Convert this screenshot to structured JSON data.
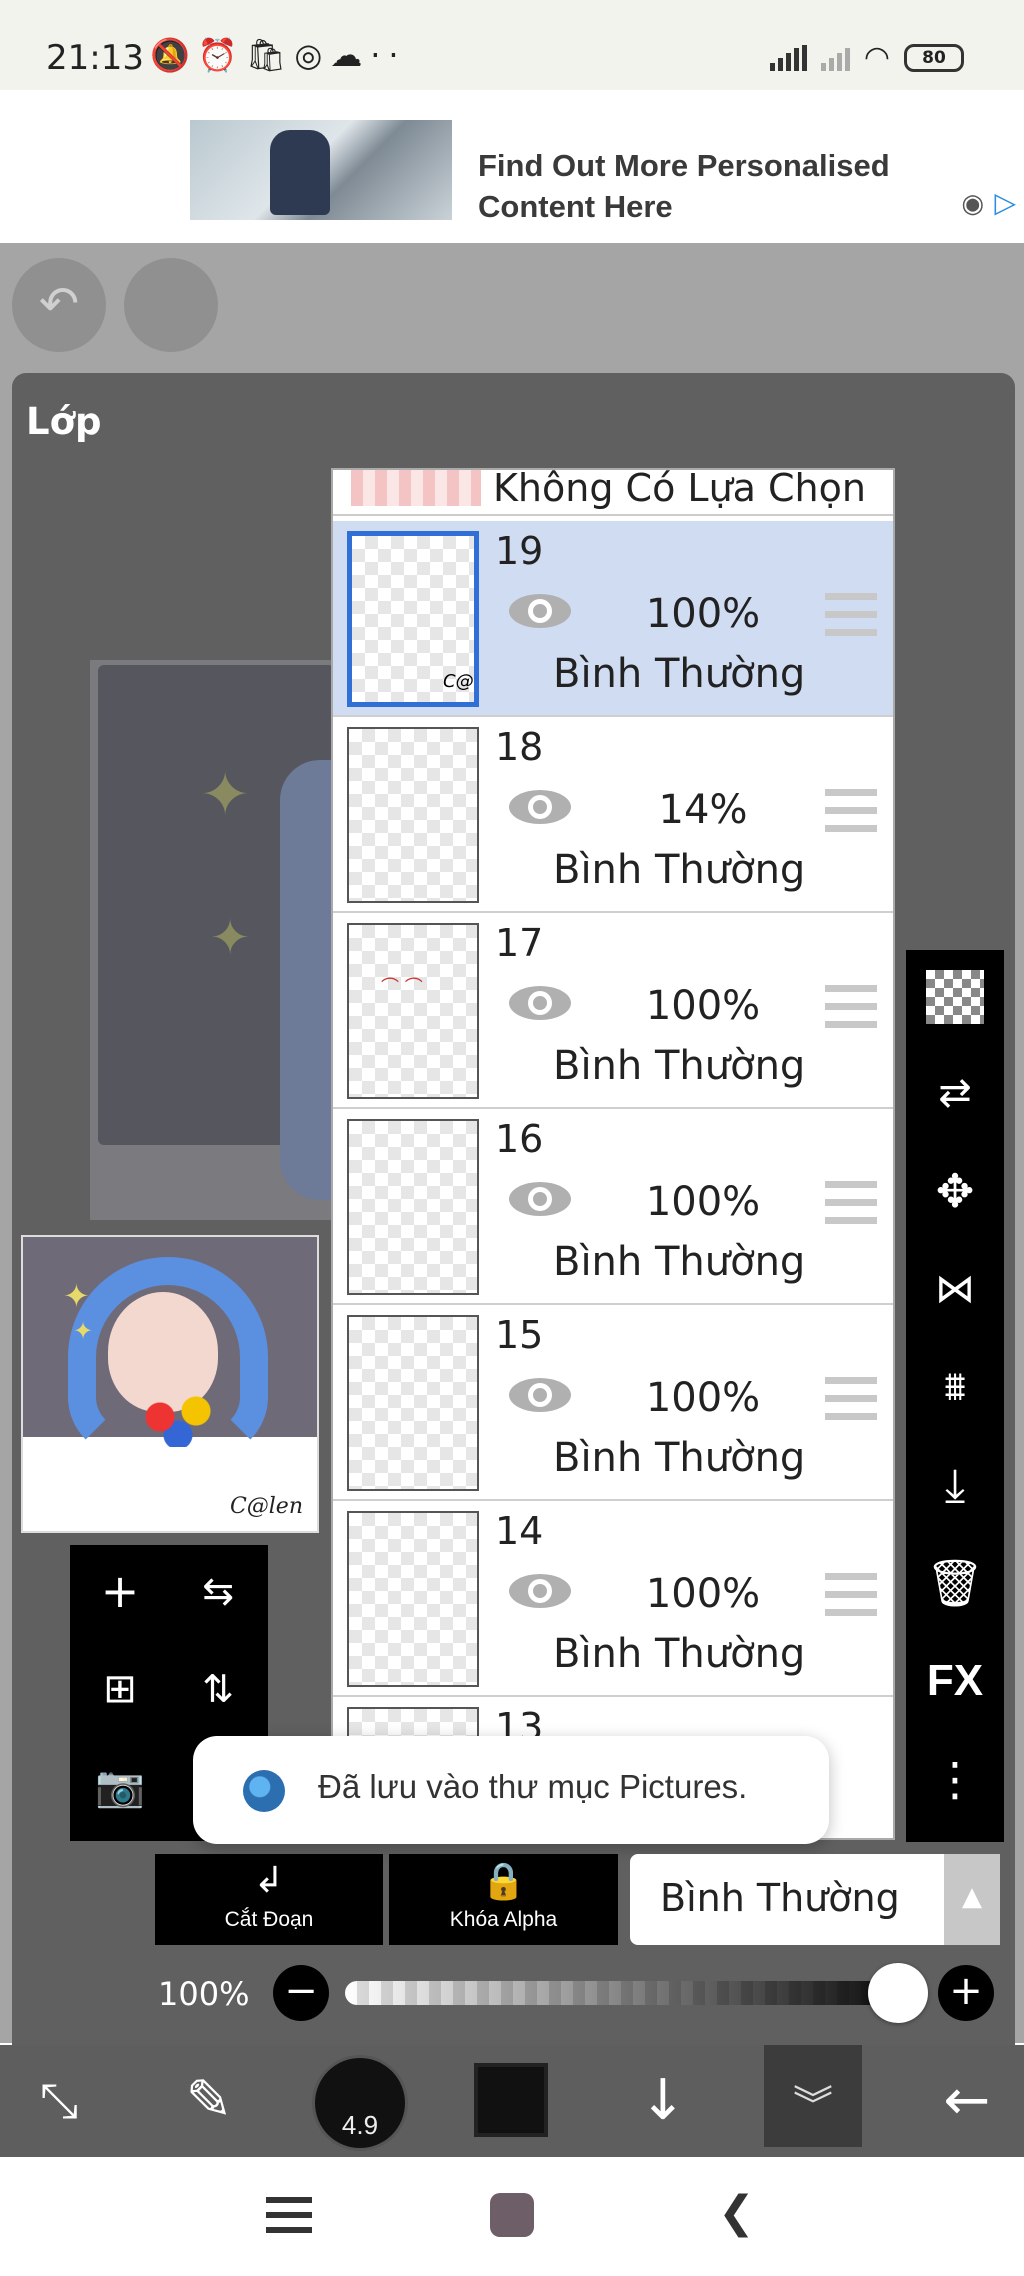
{
  "status_bar": {
    "time": "21:13",
    "left_icons": [
      "mute-icon",
      "alarm-icon",
      "bag-icon",
      "instagram-icon",
      "cloud-icon",
      "more-dots-icon"
    ],
    "battery": "80"
  },
  "ad": {
    "headline": "Find Out More Personalised Content Here"
  },
  "panel": {
    "title": "Lớp"
  },
  "layers": {
    "no_selection_label": "Không Có Lựa Chọn",
    "items": [
      {
        "number": "19",
        "opacity": "100%",
        "mode": "Bình Thường",
        "selected": true
      },
      {
        "number": "18",
        "opacity": "14%",
        "mode": "Bình Thường",
        "selected": false
      },
      {
        "number": "17",
        "opacity": "100%",
        "mode": "Bình Thường",
        "selected": false
      },
      {
        "number": "16",
        "opacity": "100%",
        "mode": "Bình Thường",
        "selected": false
      },
      {
        "number": "15",
        "opacity": "100%",
        "mode": "Bình Thường",
        "selected": false
      },
      {
        "number": "14",
        "opacity": "100%",
        "mode": "Bình Thường",
        "selected": false
      },
      {
        "number": "13",
        "opacity": "",
        "mode": "",
        "selected": false
      }
    ]
  },
  "right_tools": {
    "fx_label": "FX"
  },
  "toast": {
    "message": "Đã lưu vào thư mục Pictures."
  },
  "controls": {
    "clip_label": "Cắt Đoạn",
    "alpha_lock_label": "Khóa Alpha",
    "blend_mode": "Bình Thường",
    "opacity_label": "100%",
    "opacity_value": 1.0
  },
  "toolbar": {
    "brush_size": "4.9",
    "color": "#111111"
  },
  "colors": {
    "selected_row": "#d0dcf2",
    "selected_border": "#2f6fd6",
    "panel_bg": "#606060"
  }
}
